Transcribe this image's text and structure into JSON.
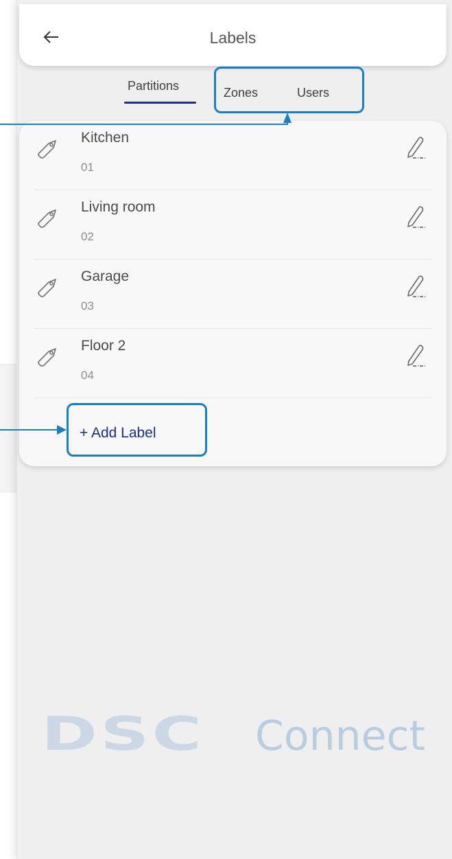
{
  "header": {
    "title": "Labels",
    "back_icon": "arrow-left-icon"
  },
  "tabs": [
    {
      "label": "Partitions",
      "active": true
    },
    {
      "label": "Zones",
      "active": false
    },
    {
      "label": "Users",
      "active": false
    }
  ],
  "labels": [
    {
      "name": "Kitchen",
      "number": "01"
    },
    {
      "name": "Living room",
      "number": "02"
    },
    {
      "name": "Garage",
      "number": "03"
    },
    {
      "name": "Floor 2",
      "number": "04"
    }
  ],
  "add_label": "+ Add Label",
  "logo": {
    "brand": "DSC",
    "product": "Connect"
  },
  "colors": {
    "accent": "#1f2f8f",
    "callout": "#1a7fc1",
    "logo": "#c5d5e5"
  },
  "icons": {
    "row_icon": "tag-icon",
    "row_action": "pencil-edit-icon"
  }
}
